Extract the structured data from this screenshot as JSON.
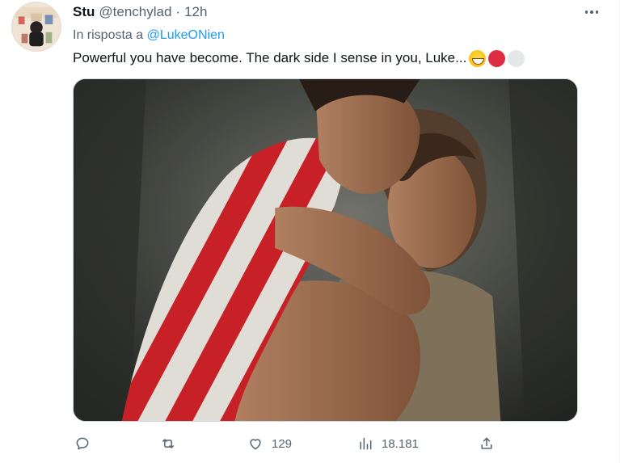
{
  "tweet": {
    "author_name": "Stu",
    "author_handle": "@tenchylad",
    "separator": "·",
    "time": "12h",
    "reply_prefix": "In risposta a",
    "reply_to": "@LukeONien",
    "text": "Powerful you have become. The dark side I sense in you, Luke...",
    "emojis": [
      "grinning-face-emoji",
      "red-circle-emoji",
      "white-circle-emoji"
    ],
    "media": {
      "description_icon": "photo"
    }
  },
  "actions": {
    "reply": {
      "icon": "reply-icon",
      "count": ""
    },
    "retweet": {
      "icon": "retweet-icon",
      "count": ""
    },
    "like": {
      "icon": "heart-icon",
      "count": "129"
    },
    "views": {
      "icon": "views-icon",
      "count": "18.181"
    },
    "share": {
      "icon": "share-icon",
      "count": ""
    }
  },
  "colors": {
    "text_primary": "#0f1419",
    "text_secondary": "#536471",
    "link": "#1d9bf0",
    "border": "#cfd9de"
  }
}
